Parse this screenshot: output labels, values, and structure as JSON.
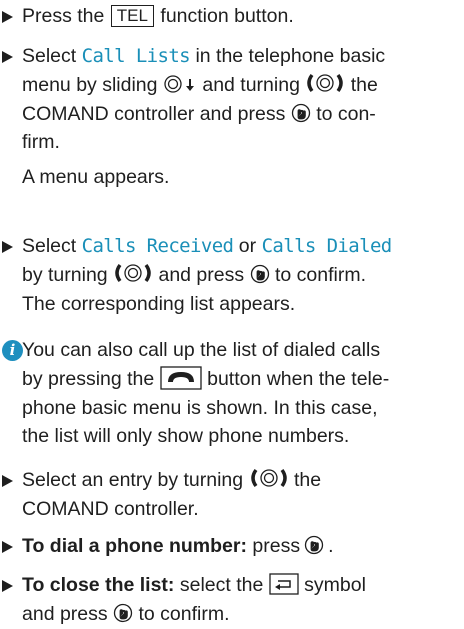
{
  "items": {
    "press_tel": {
      "pre": "Press the",
      "key": "TEL",
      "post": "function button."
    },
    "select_call_lists": {
      "l1_pre": "Select",
      "l1_hl": "Call Lists",
      "l1_post": "in the telephone basic",
      "l2_pre": "menu by sliding",
      "l2_mid": "and turning",
      "l2_post": "the",
      "l3_pre": "COMAND controller and press",
      "l3_post": "to con-",
      "l4": "firm.",
      "l5": "A menu appears."
    },
    "select_calls": {
      "l1_pre": "Select",
      "l1_hl1": "Calls Received",
      "l1_or": "or",
      "l1_hl2": "Calls Dialed",
      "l2_pre": "by turning",
      "l2_mid": "and press",
      "l2_post": "to confirm.",
      "l3": "The corresponding list appears."
    },
    "note": {
      "l1": "You can also call up the list of dialed calls",
      "l2_pre": "by pressing the",
      "l2_post": "button when the tele-",
      "l3": "phone basic menu is shown. In this case,",
      "l4": "the list will only show phone numbers."
    },
    "select_entry": {
      "l1_pre": "Select an entry by turning",
      "l1_post": "the",
      "l2": "COMAND controller."
    },
    "dial": {
      "bold": "To dial a phone number:",
      "text": "press",
      "end": "."
    },
    "close": {
      "bold": "To close the list:",
      "l1_post": "select the",
      "l1_end": "symbol",
      "l2_pre": "and press",
      "l2_post": "to confirm."
    }
  },
  "icons": {
    "controller_slide_down": "controller-slide-down-icon",
    "controller_turn": "controller-turn-icon",
    "controller_press": "controller-press-icon",
    "phone_handset": "phone-handset-icon",
    "back": "back-icon",
    "info": "info-icon"
  },
  "colors": {
    "highlight": "#1a8fb8",
    "info_badge": "#1e8fbf",
    "text": "#1f1f1f"
  }
}
